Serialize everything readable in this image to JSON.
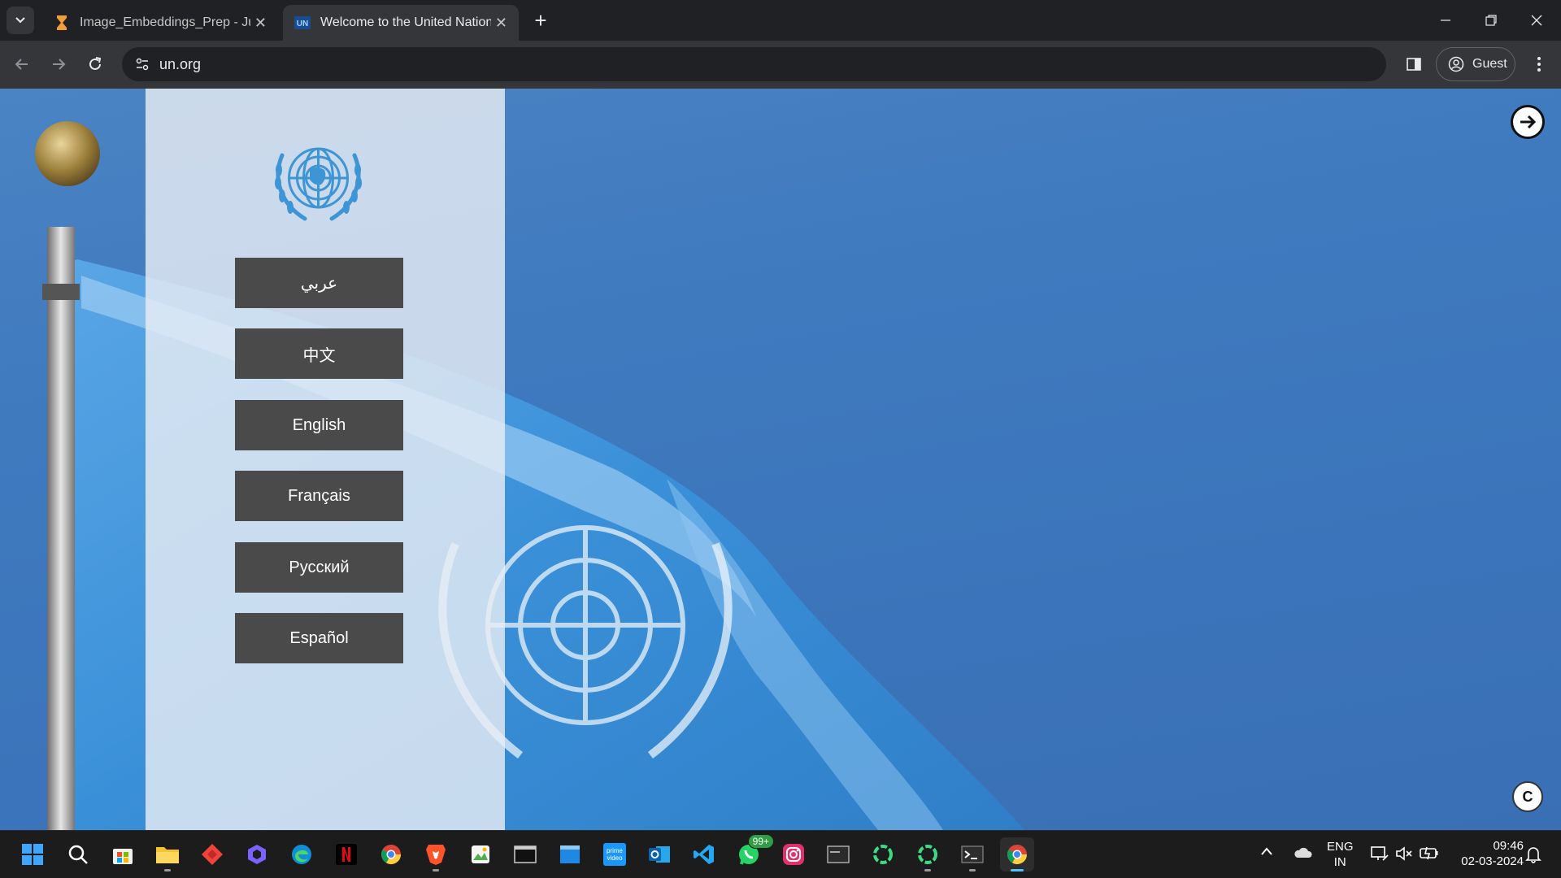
{
  "browser": {
    "tabs": [
      {
        "title": "Image_Embeddings_Prep - Jupyter",
        "active": false
      },
      {
        "title": "Welcome to the United Nations",
        "active": true
      }
    ],
    "url": "un.org",
    "profile_label": "Guest"
  },
  "page": {
    "language_buttons": [
      {
        "label": "عربي"
      },
      {
        "label": "中文"
      },
      {
        "label": "English"
      },
      {
        "label": "Français"
      },
      {
        "label": "Русский"
      },
      {
        "label": "Español"
      }
    ],
    "copyright_symbol": "C",
    "colors": {
      "panel": "#e8edf4",
      "button": "#4a4a4a",
      "sky": "#3f79be",
      "un_blue": "#3d95d6"
    }
  },
  "taskbar": {
    "apps": [
      "windows-start",
      "search",
      "microsoft-store",
      "file-explorer",
      "anydesk",
      "copilot",
      "edge",
      "netflix",
      "chrome",
      "brave",
      "photos",
      "terminal-app",
      "windows-app",
      "prime-video",
      "outlook",
      "vscode",
      "whatsapp",
      "instagram",
      "cmd",
      "cortana-ring",
      "cortana-ring-2",
      "powershell",
      "chrome-active"
    ],
    "whatsapp_badge": "99+",
    "language_line1": "ENG",
    "language_line2": "IN",
    "time": "09:46",
    "date": "02-03-2024"
  }
}
